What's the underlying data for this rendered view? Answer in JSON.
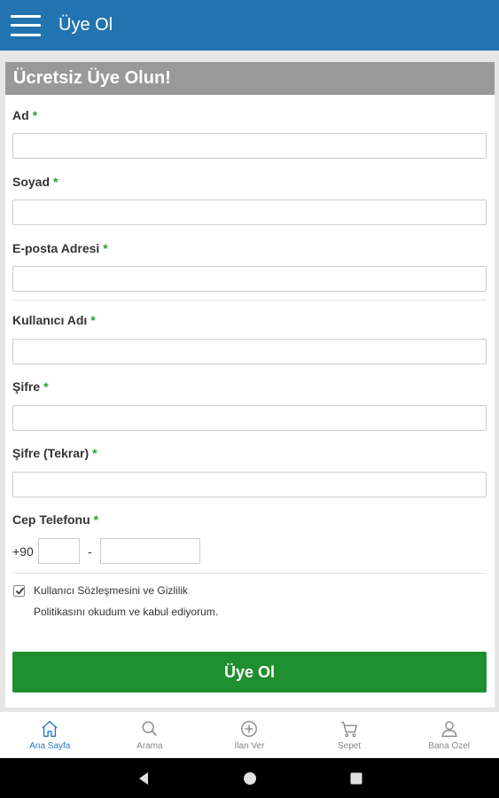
{
  "appbar": {
    "title": "Üye Ol"
  },
  "form": {
    "header": "Ücretsiz Üye Olun!",
    "required_mark": "*",
    "fields": {
      "ad": {
        "label": "Ad",
        "value": ""
      },
      "soyad": {
        "label": "Soyad",
        "value": ""
      },
      "email": {
        "label": "E-posta Adresi",
        "value": ""
      },
      "username": {
        "label": "Kullanıcı Adı",
        "value": ""
      },
      "password": {
        "label": "Şifre",
        "value": ""
      },
      "password_repeat": {
        "label": "Şifre (Tekrar)",
        "value": ""
      },
      "phone": {
        "label": "Cep Telefonu",
        "prefix": "+90",
        "separator": "-",
        "area_value": "",
        "number_value": ""
      }
    },
    "terms": {
      "line1": "Kullanıcı Sözleşmesini ve Gizlilik",
      "line2": "Politikasını okudum ve kabul ediyorum.",
      "checked": true
    },
    "submit_label": "Üye Ol"
  },
  "bottom_nav": {
    "items": [
      {
        "label": "Ana Sayfa",
        "icon": "home-icon",
        "active": true
      },
      {
        "label": "Arama",
        "icon": "search-icon",
        "active": false
      },
      {
        "label": "İlan Ver",
        "icon": "add-circle-icon",
        "active": false
      },
      {
        "label": "Sepet",
        "icon": "cart-icon",
        "active": false
      },
      {
        "label": "Bana Özel",
        "icon": "user-icon",
        "active": false
      }
    ]
  },
  "colors": {
    "appbar": "#2274b0",
    "header": "#999999",
    "accent_green": "#1f8f2f",
    "required": "#27a12e",
    "nav_active": "#2a7bc4"
  }
}
